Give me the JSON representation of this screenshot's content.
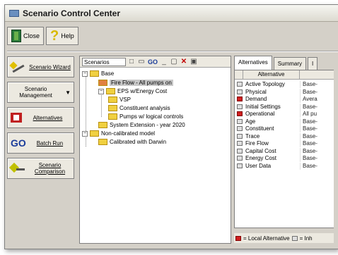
{
  "window": {
    "title": "Scenario Control Center"
  },
  "toolbar": {
    "close_label": "Close",
    "help_label": "Help"
  },
  "left_buttons": [
    {
      "label": "Scenario Wizard"
    },
    {
      "label": "Scenario Management"
    },
    {
      "label": "Alternatives"
    },
    {
      "label": "Batch Run"
    },
    {
      "label": "Scenario Comparison"
    }
  ],
  "tree": {
    "header_label": "Scenarios",
    "nodes": [
      {
        "label": "Base"
      },
      {
        "label": "Fire Flow - All pumps on"
      },
      {
        "label": "EPS w/Energy Cost"
      },
      {
        "label": "VSP"
      },
      {
        "label": "Constituent analysis"
      },
      {
        "label": "Pumps w/ logical controls"
      },
      {
        "label": "System Extension - year 2020"
      },
      {
        "label": "Non-calibrated model"
      },
      {
        "label": "Calibrated with Darwin"
      }
    ]
  },
  "tabs": [
    {
      "label": "Alternatives"
    },
    {
      "label": "Summary"
    },
    {
      "label": "I"
    }
  ],
  "grid": {
    "col_alternative": "Alternative",
    "rows": [
      {
        "name": "Active Topology",
        "value": "Base-",
        "icon": "topology-icon",
        "red": false
      },
      {
        "name": "Physical",
        "value": "Base-",
        "icon": "physical-icon",
        "red": false
      },
      {
        "name": "Demand",
        "value": "Avera",
        "icon": "demand-icon",
        "red": true
      },
      {
        "name": "Initial Settings",
        "value": "Base-",
        "icon": "initial-settings-icon",
        "red": false
      },
      {
        "name": "Operational",
        "value": "All pu",
        "icon": "operational-icon",
        "red": true
      },
      {
        "name": "Age",
        "value": "Base-",
        "icon": "age-icon",
        "red": false
      },
      {
        "name": "Constituent",
        "value": "Base-",
        "icon": "constituent-icon",
        "red": false
      },
      {
        "name": "Trace",
        "value": "Base-",
        "icon": "trace-icon",
        "red": false
      },
      {
        "name": "Fire Flow",
        "value": "Base-",
        "icon": "fire-flow-icon",
        "red": false
      },
      {
        "name": "Capital Cost",
        "value": "Base-",
        "icon": "capital-cost-icon",
        "red": false
      },
      {
        "name": "Energy Cost",
        "value": "Base-",
        "icon": "energy-cost-icon",
        "red": false
      },
      {
        "name": "User Data",
        "value": "Base-",
        "icon": "user-data-icon",
        "red": false
      }
    ]
  },
  "legend": {
    "local": "= Local Alternative",
    "inherited": "= Inh"
  }
}
